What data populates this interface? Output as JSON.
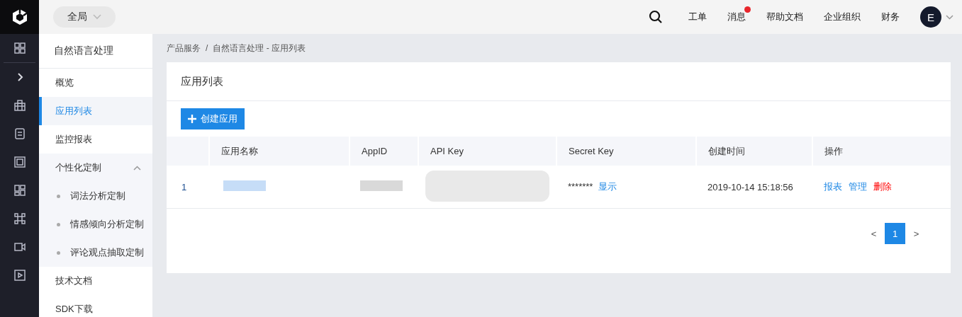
{
  "topbar": {
    "scope": "全局",
    "links": [
      {
        "label": "工单",
        "badge": false
      },
      {
        "label": "消息",
        "badge": true
      },
      {
        "label": "帮助文档",
        "badge": false
      },
      {
        "label": "企业组织",
        "badge": false
      },
      {
        "label": "财务",
        "badge": false
      }
    ],
    "avatar": "E"
  },
  "sidebar": {
    "title": "自然语言处理",
    "items": [
      {
        "label": "概览",
        "selected": false
      },
      {
        "label": "应用列表",
        "selected": true
      },
      {
        "label": "监控报表",
        "selected": false
      },
      {
        "label": "个性化定制",
        "selected": false,
        "expanded": true,
        "children": [
          {
            "label": "词法分析定制",
            "selected": false
          },
          {
            "label": "情感倾向分析定制",
            "selected": false
          },
          {
            "label": "评论观点抽取定制",
            "selected": false
          }
        ]
      },
      {
        "label": "技术文档",
        "selected": false
      },
      {
        "label": "SDK下载",
        "selected": false
      }
    ]
  },
  "breadcrumb": {
    "separator": "/",
    "items": [
      "产品服务",
      "自然语言处理 - 应用列表"
    ]
  },
  "card": {
    "title": "应用列表",
    "create_button": "创建应用",
    "table": {
      "columns": [
        "",
        "应用名称",
        "AppID",
        "API Key",
        "Secret Key",
        "创建时间",
        "操作"
      ],
      "rows": [
        {
          "cells": [
            {
              "kind": "index",
              "text": "1"
            },
            {
              "kind": "redacted"
            },
            {
              "kind": "redacted"
            },
            {
              "kind": "redacted"
            },
            {
              "kind": "secret",
              "text": "*******",
              "action": "显示"
            },
            {
              "kind": "text",
              "text": "2019-10-14 15:18:56"
            },
            {
              "kind": "actions",
              "actions": [
                {
                  "label": "报表",
                  "danger": false
                },
                {
                  "label": "管理",
                  "danger": false
                },
                {
                  "label": "删除",
                  "danger": true
                }
              ]
            }
          ]
        }
      ]
    },
    "pagination": {
      "prev": "<",
      "pages": [
        {
          "label": "1",
          "selected": true
        }
      ],
      "next": ">"
    }
  }
}
